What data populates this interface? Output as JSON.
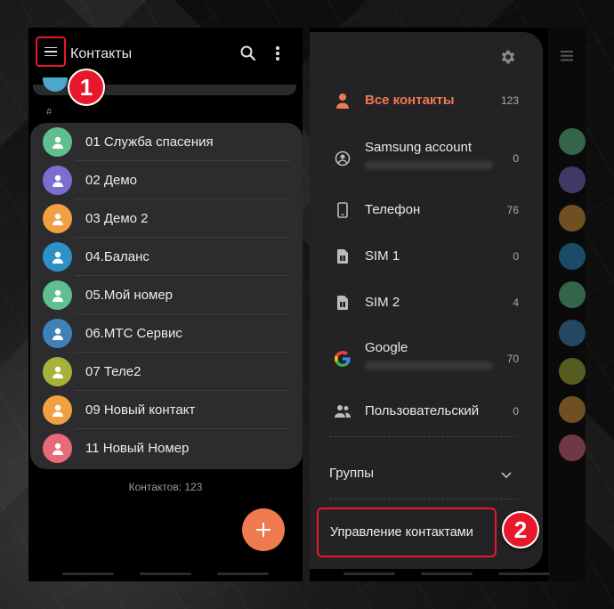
{
  "header": {
    "title": "Контакты"
  },
  "list": {
    "section_letter": "#",
    "contacts": [
      {
        "name": "01 Служба спасения",
        "color": "#5fbf8f"
      },
      {
        "name": "02 Демо",
        "color": "#7a6fd0"
      },
      {
        "name": "03 Демо 2",
        "color": "#f0a040"
      },
      {
        "name": "04.Баланс",
        "color": "#2e90c8"
      },
      {
        "name": "05.Мой номер",
        "color": "#5fbf8f"
      },
      {
        "name": "06.МТС Сервис",
        "color": "#3f82b8"
      },
      {
        "name": "07 Теле2",
        "color": "#a7b23a"
      },
      {
        "name": "09 Новый контакт",
        "color": "#f0a040"
      },
      {
        "name": "11 Новый Номер",
        "color": "#e8697a"
      }
    ],
    "count_label": "Контактов: 123"
  },
  "badges": {
    "one": "1",
    "two": "2"
  },
  "drawer": {
    "items": [
      {
        "label": "Все контакты",
        "count": "123",
        "icon": "person-icon"
      },
      {
        "label": "Samsung account",
        "count": "0",
        "icon": "account-circle-icon"
      },
      {
        "label": "Телефон",
        "count": "76",
        "icon": "phone-icon"
      },
      {
        "label": "SIM 1",
        "count": "0",
        "icon": "sim-card-icon"
      },
      {
        "label": "SIM 2",
        "count": "4",
        "icon": "sim-card-icon"
      },
      {
        "label": "Google",
        "count": "70",
        "icon": "google-icon"
      },
      {
        "label": "Пользовательский",
        "count": "0",
        "icon": "people-icon"
      }
    ],
    "groups_label": "Группы",
    "manage_label": "Управление контактами"
  },
  "colors": {
    "accent": "#f07a4f",
    "highlight": "#e8182b"
  }
}
